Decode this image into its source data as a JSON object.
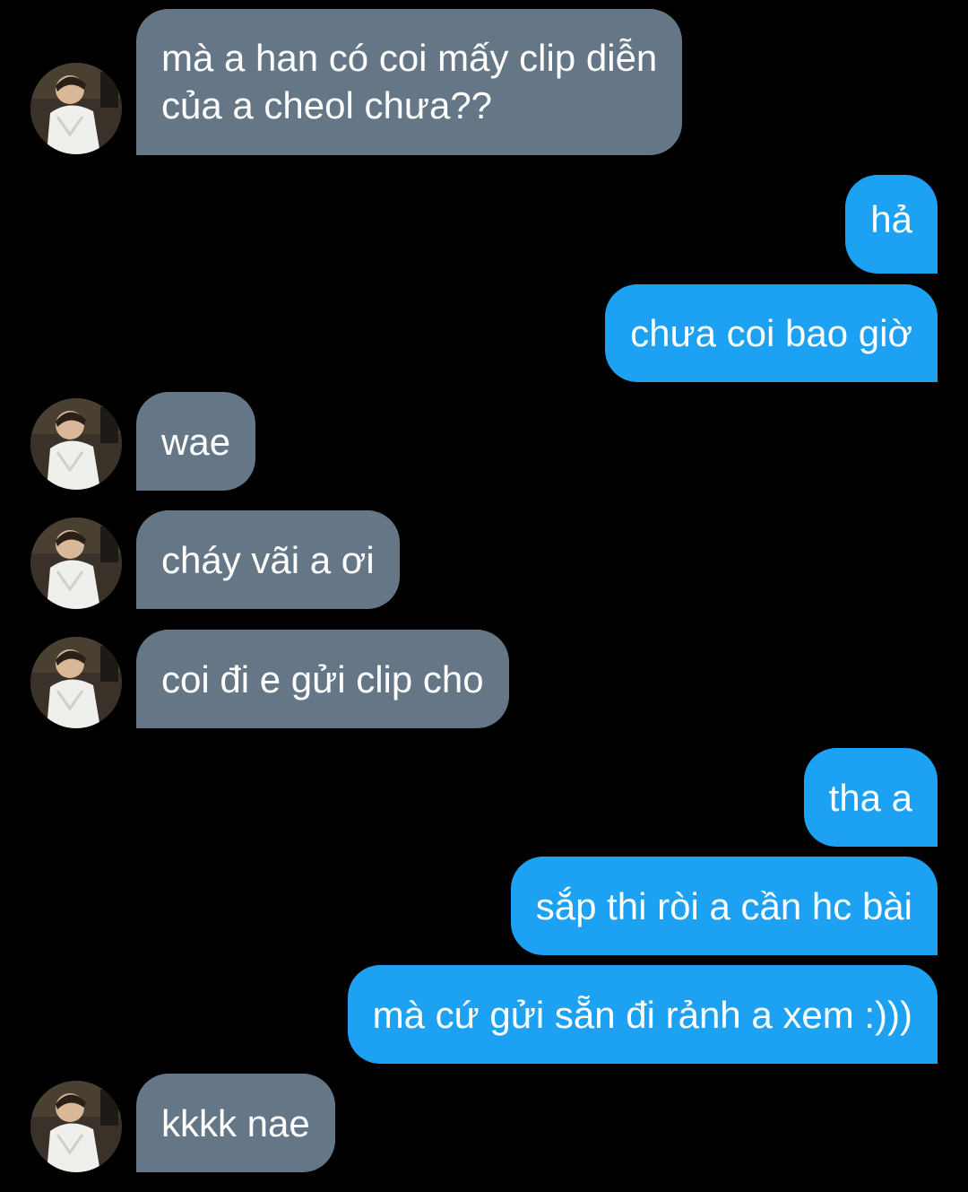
{
  "conversation": {
    "messages": [
      {
        "sender": "them",
        "lines": [
          "mà a han có coi mấy clip diễn",
          "của a cheol chưa??"
        ]
      },
      {
        "sender": "me",
        "text": "hả"
      },
      {
        "sender": "me",
        "text": "chưa coi bao giờ"
      },
      {
        "sender": "them",
        "text": "wae"
      },
      {
        "sender": "them",
        "text": "cháy vãi a ơi"
      },
      {
        "sender": "them",
        "text": "coi đi e gửi clip cho"
      },
      {
        "sender": "me",
        "text": "tha a"
      },
      {
        "sender": "me",
        "text": "sắp thi ròi a cần hc bài"
      },
      {
        "sender": "me",
        "text": "mà cứ gửi sẵn đi rảnh a xem :)))"
      },
      {
        "sender": "them",
        "text": "kkkk nae"
      }
    ]
  },
  "colors": {
    "background": "#000000",
    "incoming_bubble": "#657786",
    "outgoing_bubble": "#1da1f2",
    "text": "#ffffff"
  },
  "icons": {
    "avatar": "profile-photo-person-icon"
  }
}
